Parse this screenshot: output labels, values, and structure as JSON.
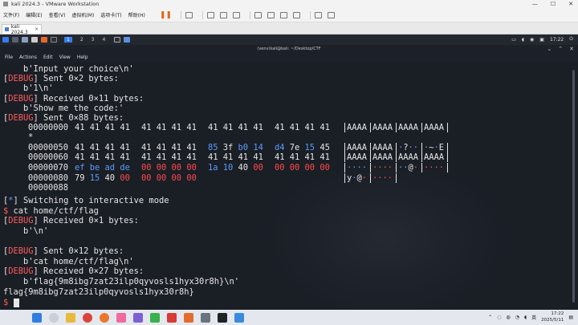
{
  "vm": {
    "window_title": "kali 2024.3 - VMware Workstation",
    "menu": [
      "文件(F)",
      "编辑(E)",
      "查看(V)",
      "虚拟机(M)",
      "选项卡(T)",
      "帮助(H)"
    ],
    "tab_label": "kali 2024.3",
    "tab_close": "×"
  },
  "kali": {
    "workspaces": [
      "1",
      "2",
      "3",
      "4"
    ],
    "active_workspace": "1",
    "clock": "17:22"
  },
  "terminal": {
    "title": "(venv)kali@kali: ~/Desktop/CTF",
    "menu": [
      "File",
      "Actions",
      "Edit",
      "View",
      "Help"
    ],
    "lines": [
      "    b'Input your choice\\n'",
      "[DEBUG] Sent 0×2 bytes:",
      "    b'1\\n'",
      "[DEBUG] Received 0×11 bytes:",
      "    b'Show me the code:'",
      "[DEBUG] Sent 0×88 bytes:"
    ],
    "hexdump": {
      "offsets": [
        "00000000",
        "*",
        "00000050",
        "00000060",
        "00000070",
        "00000080",
        "00000088"
      ],
      "rows": [
        {
          "bytes": [
            "41 41 41 41",
            "41 41 41 41",
            "41 41 41 41",
            "41 41 41 41"
          ],
          "ascii": [
            "AAAA",
            "AAAA",
            "AAAA",
            "AAAA"
          ]
        },
        {
          "bytes": [
            "41 41 41 41",
            "41 41 41 41",
            "85 3f b0 14",
            "d4 7e 15 45"
          ],
          "ascii": [
            "AAAA",
            "AAAA",
            "·?··",
            "·~·E"
          ]
        },
        {
          "bytes": [
            "41 41 41 41",
            "41 41 41 41",
            "41 41 41 41",
            "41 41 41 41"
          ],
          "ascii": [
            "AAAA",
            "AAAA",
            "AAAA",
            "AAAA"
          ]
        },
        {
          "bytes": [
            "ef be ad de",
            "00 00 00 00",
            "1a 10 40 00",
            "00 00 00 00"
          ],
          "ascii": [
            "····",
            "····",
            "··@·",
            "····"
          ]
        },
        {
          "bytes": [
            "79 15 40 00",
            "00 00 00 00"
          ],
          "ascii": [
            "y·@·",
            "····"
          ]
        }
      ]
    },
    "lines2": [
      "[*] Switching to interactive mode",
      "$ cat home/ctf/flag",
      "[DEBUG] Received 0×1 bytes:",
      "    b'\\n'",
      "",
      "[DEBUG] Sent 0×12 bytes:",
      "    b'cat home/ctf/flag\\n'",
      "[DEBUG] Received 0×27 bytes:",
      "    b'flag{9m8ibg7zat23ilp0qyvosls1hyx30r8h}\\n'",
      "flag{9m8ibg7zat23ilp0qyvosls1hyx30r8h}",
      "$ "
    ]
  },
  "taskbar": {
    "time": "17:22",
    "date": "2025/5/11",
    "ime": "英"
  },
  "colors": {
    "debug_red": "#ff5c5c",
    "info_blue": "#5b9cff",
    "terminal_bg": "#1a1e25"
  }
}
